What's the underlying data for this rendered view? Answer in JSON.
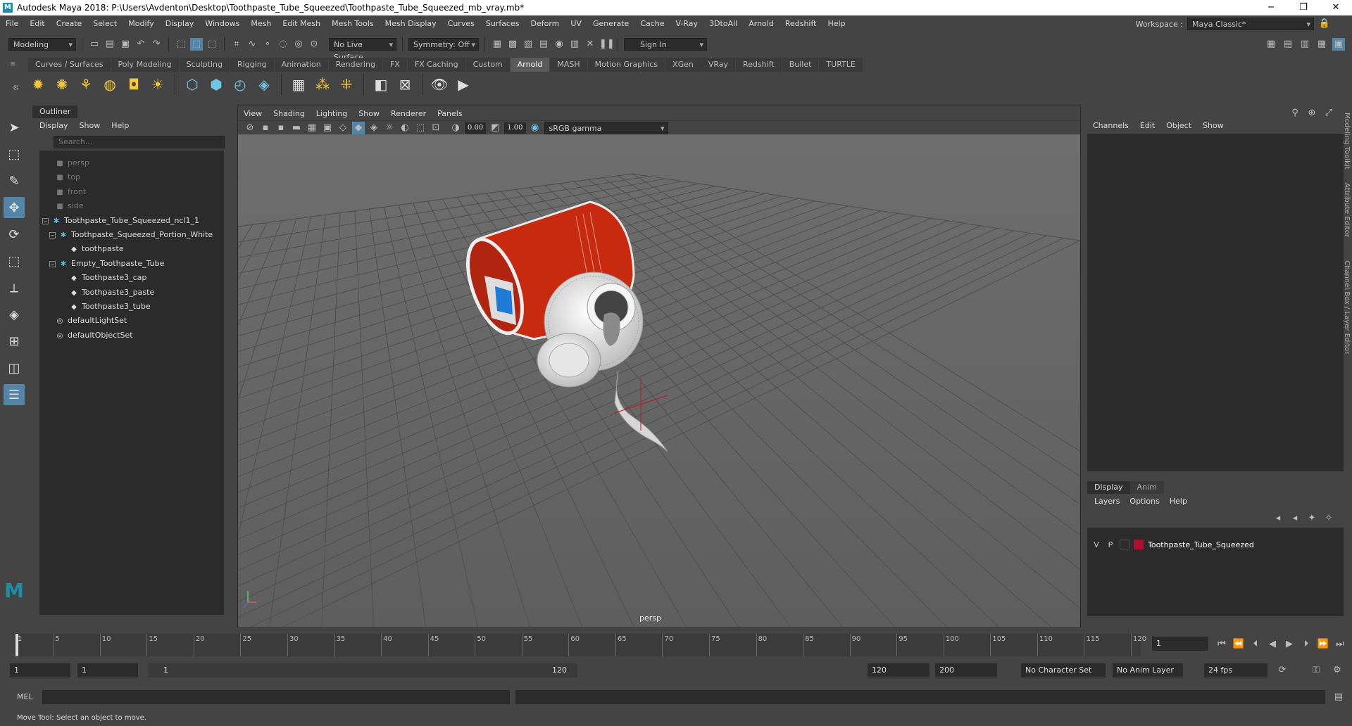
{
  "window": {
    "title": "Autodesk Maya 2018: P:\\Users\\Avdenton\\Desktop\\Toothpaste_Tube_Squeezed\\Toothpaste_Tube_Squeezed_mb_vray.mb*",
    "logo": "M"
  },
  "menu": [
    "File",
    "Edit",
    "Create",
    "Select",
    "Modify",
    "Display",
    "Windows",
    "Mesh",
    "Edit Mesh",
    "Mesh Tools",
    "Mesh Display",
    "Curves",
    "Surfaces",
    "Deform",
    "UV",
    "Generate",
    "Cache",
    "V-Ray",
    "3DtoAll",
    "Arnold",
    "Redshift",
    "Help"
  ],
  "workspace": {
    "label": "Workspace :",
    "value": "Maya Classic*"
  },
  "statusline": {
    "mode": "Modeling",
    "live_surface": "No Live Surface",
    "symmetry": "Symmetry: Off",
    "sign_in": "Sign In"
  },
  "shelf_tabs": [
    "Curves / Surfaces",
    "Poly Modeling",
    "Sculpting",
    "Rigging",
    "Animation",
    "Rendering",
    "FX",
    "FX Caching",
    "Custom",
    "Arnold",
    "MASH",
    "Motion Graphics",
    "XGen",
    "VRay",
    "Redshift",
    "Bullet",
    "TURTLE"
  ],
  "shelf_active": "Arnold",
  "outliner": {
    "tab": "Outliner",
    "menu": [
      "Display",
      "Show",
      "Help"
    ],
    "search_placeholder": "Search...",
    "nodes": [
      {
        "label": "persp",
        "kind": "camera",
        "dim": true,
        "depth": 0,
        "exp": ""
      },
      {
        "label": "top",
        "kind": "camera",
        "dim": true,
        "depth": 0,
        "exp": ""
      },
      {
        "label": "front",
        "kind": "camera",
        "dim": true,
        "depth": 0,
        "exp": ""
      },
      {
        "label": "side",
        "kind": "camera",
        "dim": true,
        "depth": 0,
        "exp": ""
      },
      {
        "label": "Toothpaste_Tube_Squeezed_ncl1_1",
        "kind": "group",
        "dim": false,
        "depth": 0,
        "exp": "−"
      },
      {
        "label": "Toothpaste_Squeezed_Portion_White",
        "kind": "group",
        "dim": false,
        "depth": 1,
        "exp": "−"
      },
      {
        "label": "toothpaste",
        "kind": "mesh",
        "dim": false,
        "depth": 2,
        "exp": ""
      },
      {
        "label": "Empty_Toothpaste_Tube",
        "kind": "group",
        "dim": false,
        "depth": 1,
        "exp": "−"
      },
      {
        "label": "Toothpaste3_cap",
        "kind": "mesh",
        "dim": false,
        "depth": 2,
        "exp": ""
      },
      {
        "label": "Toothpaste3_paste",
        "kind": "mesh",
        "dim": false,
        "depth": 2,
        "exp": ""
      },
      {
        "label": "Toothpaste3_tube",
        "kind": "mesh",
        "dim": false,
        "depth": 2,
        "exp": ""
      },
      {
        "label": "defaultLightSet",
        "kind": "set",
        "dim": false,
        "depth": 0,
        "exp": ""
      },
      {
        "label": "defaultObjectSet",
        "kind": "set",
        "dim": false,
        "depth": 0,
        "exp": ""
      }
    ]
  },
  "viewport": {
    "menu": [
      "View",
      "Shading",
      "Lighting",
      "Show",
      "Renderer",
      "Panels"
    ],
    "exposure": "0.00",
    "gamma": "1.00",
    "color_space": "sRGB gamma",
    "camera": "persp"
  },
  "channel_box": {
    "menu": [
      "Channels",
      "Edit",
      "Object",
      "Show"
    ],
    "layer_tabs": [
      "Display",
      "Anim"
    ],
    "layer_menu": [
      "Layers",
      "Options",
      "Help"
    ],
    "layer": {
      "v": "V",
      "p": "P",
      "name": "Toothpaste_Tube_Squeezed",
      "color": "#b01030"
    },
    "side_tabs": [
      "Modeling Toolkit",
      "Attribute Editor",
      "Channel Box / Layer Editor"
    ]
  },
  "timeline": {
    "ticks": [
      "1",
      "5",
      "10",
      "15",
      "20",
      "25",
      "30",
      "35",
      "40",
      "45",
      "50",
      "55",
      "60",
      "65",
      "70",
      "75",
      "80",
      "85",
      "90",
      "95",
      "100",
      "105",
      "110",
      "115",
      "120"
    ],
    "current_frame": "1"
  },
  "range": {
    "start": "1",
    "start2": "1",
    "slider_start": "1",
    "slider_end": "120",
    "end": "120",
    "end2": "200",
    "char_set": "No Character Set",
    "anim_layer": "No Anim Layer",
    "fps": "24 fps"
  },
  "mel": {
    "label": "MEL"
  },
  "help_line": "Move Tool: Select an object to move."
}
